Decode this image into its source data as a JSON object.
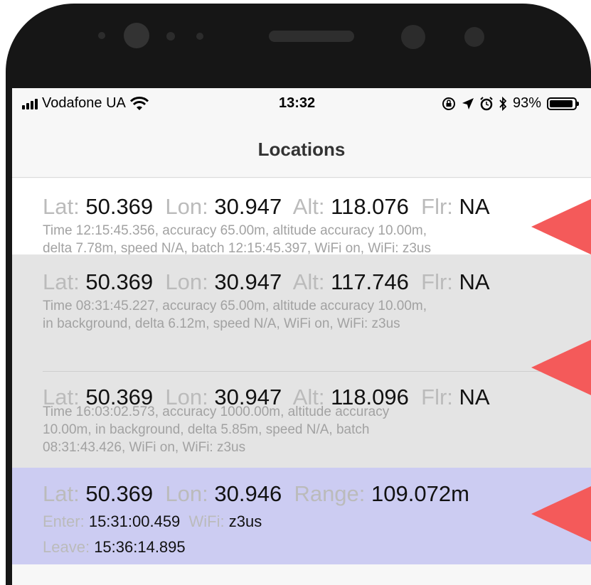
{
  "status_bar": {
    "carrier": "Vodafone UA",
    "time": "13:32",
    "battery_percent": "93%",
    "battery_level": 0.93,
    "icons": [
      "signal-icon",
      "wifi-icon",
      "orientation-lock-icon",
      "location-arrow-icon",
      "alarm-icon",
      "bluetooth-icon",
      "battery-icon"
    ]
  },
  "nav": {
    "title": "Locations"
  },
  "labels": {
    "lat": "Lat:",
    "lon": "Lon:",
    "alt": "Alt:",
    "flr": "Flr:",
    "range": "Range:",
    "enter": "Enter:",
    "leave": "Leave:",
    "wifi": "WiFi:"
  },
  "locations": [
    {
      "lat": "50.369",
      "lon": "30.947",
      "alt": "118.076",
      "flr": "NA",
      "detail_lines": [
        "Time 12:15:45.356, accuracy 65.00m, altitude accuracy 10.00m,",
        "delta 7.78m, speed N/A, batch 12:15:45.397, WiFi on, WiFi: z3us"
      ]
    },
    {
      "lat": "50.369",
      "lon": "30.947",
      "alt": "117.746",
      "flr": "NA",
      "detail_lines": [
        "Time 08:31:45.227, accuracy 65.00m, altitude accuracy 10.00m,",
        "in background, delta 6.12m, speed N/A, WiFi on, WiFi: z3us"
      ]
    },
    {
      "lat": "50.369",
      "lon": "30.947",
      "alt": "118.096",
      "flr": "NA",
      "detail_lines": [
        "Time 16:03:02.573, accuracy 1000.00m, altitude accuracy",
        "10.00m, in background, delta 5.85m, speed N/A, batch",
        "08:31:43.426, WiFi on, WiFi: z3us"
      ]
    }
  ],
  "visit": {
    "lat": "50.369",
    "lon": "30.946",
    "range": "109.072m",
    "enter": "15:31:00.459",
    "wifi": "z3us",
    "leave": "15:36:14.895"
  },
  "colors": {
    "arrow": "#f45a5a",
    "visit_row": "#ccccf2",
    "background_row": "#e4e4e4"
  }
}
